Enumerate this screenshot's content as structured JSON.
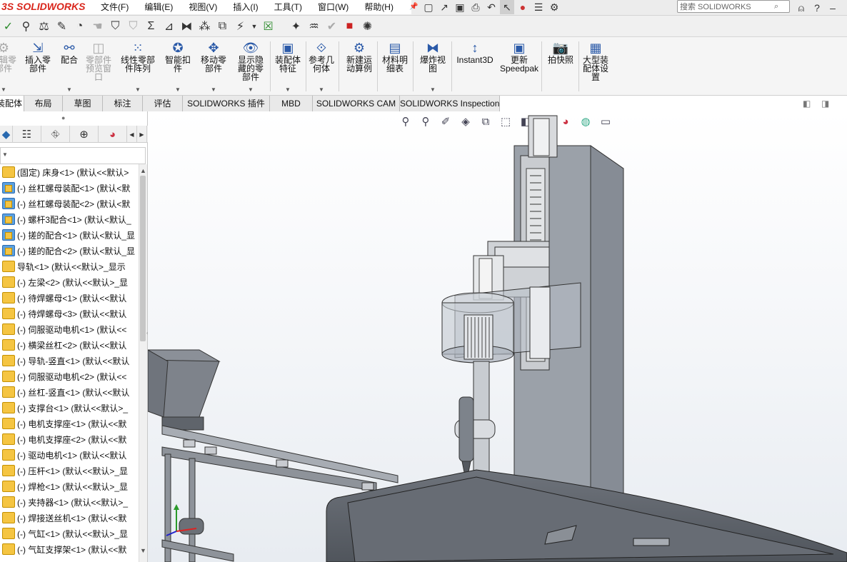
{
  "app": {
    "logo_text": "SOLIDWORKS"
  },
  "menu": [
    "文件(F)",
    "编辑(E)",
    "视图(V)",
    "插入(I)",
    "工具(T)",
    "窗口(W)",
    "帮助(H)"
  ],
  "search": {
    "placeholder": "搜索 SOLIDWORKS"
  },
  "command_manager": [
    {
      "label": "编辑零\n部件",
      "enabled": false
    },
    {
      "label": "插入零\n部件",
      "enabled": true
    },
    {
      "label": "配合",
      "enabled": true
    },
    {
      "label": "零部件\n预览窗\n口",
      "enabled": false
    },
    {
      "label": "线性零部\n件阵列",
      "enabled": true
    },
    {
      "label": "智能扣\n件",
      "enabled": true
    },
    {
      "label": "移动零\n部件",
      "enabled": true
    },
    {
      "label": "显示隐\n藏的零\n部件",
      "enabled": true
    },
    {
      "label": "装配体\n特征",
      "enabled": true
    },
    {
      "label": "参考几\n何体",
      "enabled": true
    },
    {
      "label": "新建运\n动算例",
      "enabled": true
    },
    {
      "label": "材料明\n细表",
      "enabled": true
    },
    {
      "label": "爆炸视\n图",
      "enabled": true
    },
    {
      "label": "Instant3D",
      "enabled": true
    },
    {
      "label": "更新\nSpeedpak",
      "enabled": true
    },
    {
      "label": "拍快照",
      "enabled": true
    },
    {
      "label": "大型装\n配体设\n置",
      "enabled": true
    }
  ],
  "tabs": [
    {
      "label": "装配体",
      "active": true
    },
    {
      "label": "布局"
    },
    {
      "label": "草图"
    },
    {
      "label": "标注"
    },
    {
      "label": "评估"
    },
    {
      "label": "SOLIDWORKS 插件"
    },
    {
      "label": "MBD"
    },
    {
      "label": "SOLIDWORKS CAM"
    },
    {
      "label": "SOLIDWORKS Inspection"
    }
  ],
  "tree": [
    {
      "text": "(固定) 床身<1> (默认<<默认>",
      "icon": "part"
    },
    {
      "text": "(-) 丝杠螺母装配<1> (默认<默",
      "icon": "assembly"
    },
    {
      "text": "(-) 丝杠螺母装配<2> (默认<默",
      "icon": "assembly"
    },
    {
      "text": "(-) 螺杆3配合<1> (默认<默认_",
      "icon": "assembly"
    },
    {
      "text": "(-) 搓的配合<1> (默认<默认_显",
      "icon": "assembly"
    },
    {
      "text": "(-) 搓的配合<2> (默认<默认_显",
      "icon": "assembly"
    },
    {
      "text": "导轨<1> (默认<<默认>_显示",
      "icon": "part"
    },
    {
      "text": "(-) 左梁<2> (默认<<默认>_显",
      "icon": "part"
    },
    {
      "text": "(-) 待焊螺母<1> (默认<<默认",
      "icon": "part"
    },
    {
      "text": "(-) 待焊螺母<3> (默认<<默认",
      "icon": "part"
    },
    {
      "text": "(-) 伺服驱动电机<1> (默认<<",
      "icon": "part"
    },
    {
      "text": "(-) 横梁丝杠<2> (默认<<默认",
      "icon": "part"
    },
    {
      "text": "(-) 导轨-竖直<1> (默认<<默认",
      "icon": "part"
    },
    {
      "text": "(-) 伺服驱动电机<2> (默认<<",
      "icon": "part"
    },
    {
      "text": "(-) 丝杠-竖直<1> (默认<<默认",
      "icon": "part"
    },
    {
      "text": "(-) 支撑台<1> (默认<<默认>_",
      "icon": "part"
    },
    {
      "text": "(-) 电机支撑座<1> (默认<<默",
      "icon": "part"
    },
    {
      "text": "(-) 电机支撑座<2> (默认<<默",
      "icon": "part"
    },
    {
      "text": "(-) 驱动电机<1> (默认<<默认",
      "icon": "part"
    },
    {
      "text": "(-) 压杆<1> (默认<<默认>_显",
      "icon": "part"
    },
    {
      "text": "(-) 焊枪<1> (默认<<默认>_显",
      "icon": "part"
    },
    {
      "text": "(-) 夹持器<1> (默认<<默认>_",
      "icon": "part"
    },
    {
      "text": "(-) 焊接送丝机<1> (默认<<默",
      "icon": "part"
    },
    {
      "text": "(-) 气缸<1> (默认<<默认>_显",
      "icon": "part"
    },
    {
      "text": "(-) 气缸支撑架<1> (默认<<默",
      "icon": "part"
    }
  ]
}
